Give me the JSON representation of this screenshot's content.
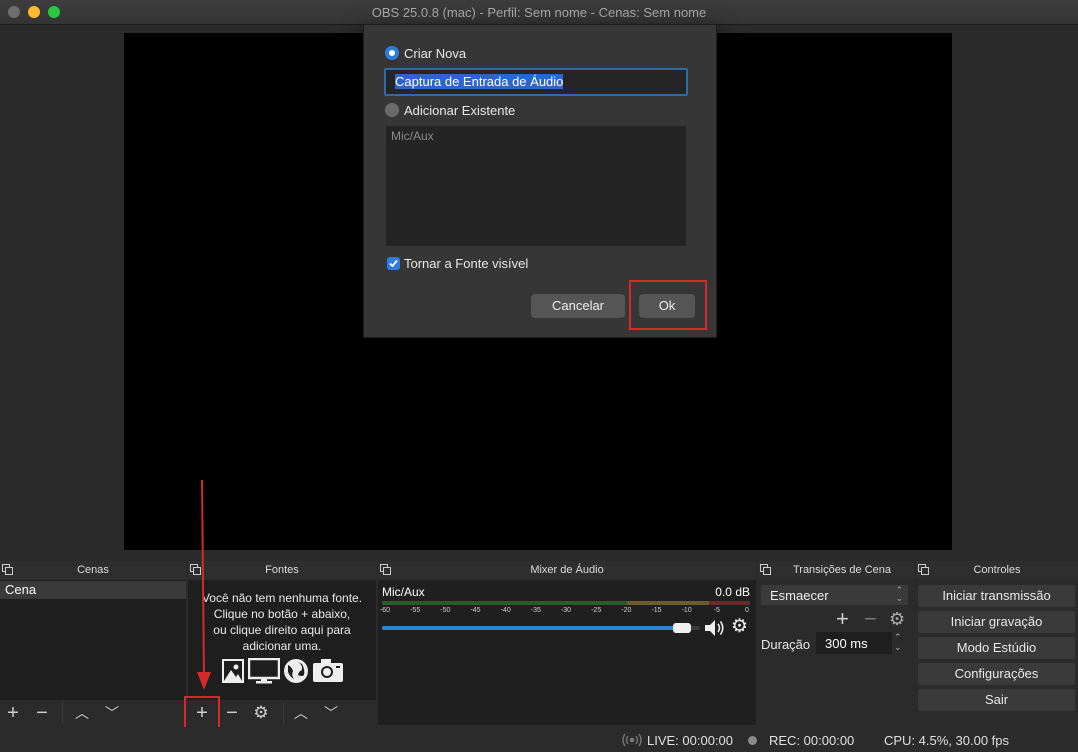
{
  "window": {
    "title": "OBS 25.0.8 (mac) - Perfil: Sem nome - Cenas: Sem nome",
    "traffic_colors": {
      "close": "#fe5f57",
      "minimize": "#febc2e",
      "maximize": "#28c840"
    }
  },
  "dialog": {
    "create_new_label": "Criar Nova",
    "name_value": "Captura de Entrada de Áudio",
    "add_existing_label": "Adicionar Existente",
    "existing_items": [
      "Mic/Aux"
    ],
    "make_visible_label": "Tornar a Fonte visível",
    "cancel_label": "Cancelar",
    "ok_label": "Ok"
  },
  "docks": {
    "scenes": {
      "title": "Cenas",
      "items": [
        "Cena"
      ]
    },
    "sources": {
      "title": "Fontes",
      "empty_text_line1": "Você não tem nenhuma fonte.",
      "empty_text_line2": "Clique no botão + abaixo,",
      "empty_text_line3": "ou clique direito aqui para",
      "empty_text_line4": "adicionar uma."
    },
    "mixer": {
      "title": "Mixer de Áudio",
      "channel_name": "Mic/Aux",
      "channel_db": "0.0 dB",
      "volume_fraction": 0.97,
      "ticks": [
        "-60",
        "-55",
        "-50",
        "-45",
        "-40",
        "-35",
        "-30",
        "-25",
        "-20",
        "-15",
        "-10",
        "-5",
        "0"
      ]
    },
    "transitions": {
      "title": "Transições de Cena",
      "selected": "Esmaecer",
      "duration_label": "Duração",
      "duration_value": "300 ms"
    },
    "controls": {
      "title": "Controles",
      "buttons": [
        "Iniciar transmissão",
        "Iniciar gravação",
        "Modo Estúdio",
        "Configurações",
        "Sair"
      ]
    }
  },
  "status": {
    "live": "LIVE: 00:00:00",
    "rec": "REC: 00:00:00",
    "cpu": "CPU: 4.5%, 30.00 fps"
  },
  "colors": {
    "accent": "#2f64c8",
    "highlight": "#d42a2a"
  }
}
